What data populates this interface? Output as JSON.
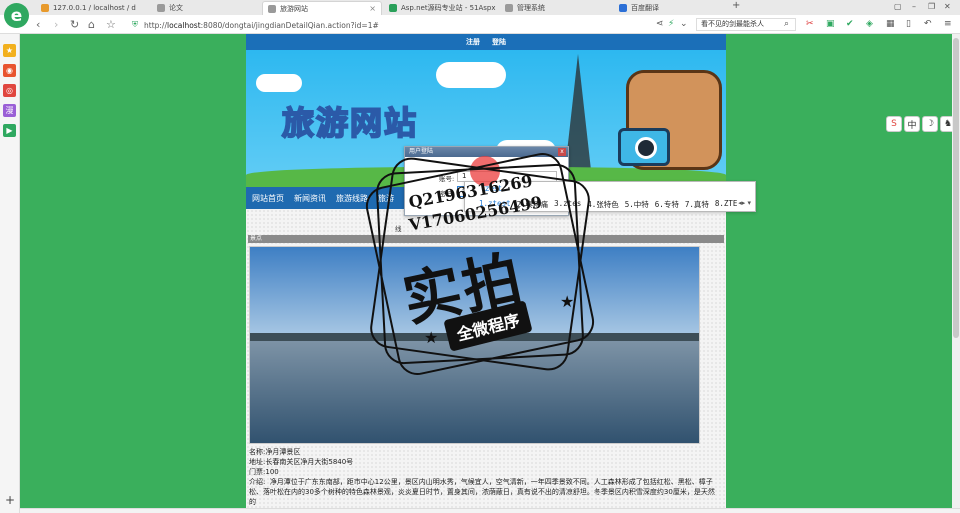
{
  "browser": {
    "tabs": [
      {
        "label": "127.0.0.1 / localhost / db_dongtai",
        "color": "#e89a2c"
      },
      {
        "label": "论文",
        "color": "#9a9a9a"
      },
      {
        "label": "旅游网站",
        "color": "#9a9a9a"
      },
      {
        "label": "Asp.net源码专业站 - 51Aspx.com",
        "color": "#2aa05a"
      },
      {
        "label": "管理系统",
        "color": "#9a9a9a"
      },
      {
        "label": "百度翻译",
        "color": "#2b6fd6"
      }
    ],
    "active_tab_index": 2,
    "new_tab_glyph": "+",
    "address": {
      "scheme": "http://",
      "host": "localhost",
      "path": ":8080/dongtai/jingdianDetailQian.action?id=1#"
    },
    "search_text": "看不见的剑最能杀人",
    "logo_glyph": "e"
  },
  "sidebar": {
    "icons": [
      {
        "name": "favorites-star-icon",
        "glyph": "★",
        "color": "#f2b01e"
      },
      {
        "name": "weibo-icon",
        "glyph": "◉",
        "color": "#e8532f"
      },
      {
        "name": "target-icon",
        "glyph": "◎",
        "color": "#e0463f"
      },
      {
        "name": "manga-icon",
        "glyph": "漫",
        "color": "#9a5fd6"
      },
      {
        "name": "video-icon",
        "glyph": "▶",
        "color": "#2fa860"
      }
    ],
    "add_glyph": "+"
  },
  "site": {
    "top_links": [
      "注册",
      "登陆"
    ],
    "banner_title": "旅游网站",
    "nav_items": [
      "网站首页",
      "新闻资讯",
      "旅游线路",
      "旅游"
    ],
    "section_header": "景点",
    "login_dialog": {
      "title": "用户登陆",
      "close": "x",
      "account_label": "账号:",
      "account_value": "1",
      "password_label": "密码:",
      "password_value": "ztest",
      "line_label": "线"
    },
    "details": {
      "name_label": "名称:",
      "name_value": "净月潭景区",
      "address_label": "地址:",
      "address_value": "长春南关区净月大街5840号",
      "tickets_label": "门票:",
      "tickets_value": "100",
      "intro_label": "介绍:",
      "intro_value": "净月潭位于广东东南部，距市中心12公里，景区内山明水秀，气候宜人，空气清新，一年四季景致不同。人工森林形成了包括红松、黑松、樟子松、落叶松在内的30多个树种的特色森林景观，炎炎夏日时节，置身其间，浓荫蔽日，真有说不出的清凉舒坦。冬季景区内积雪深度约30厘米，是天然的"
    }
  },
  "ime": {
    "composition": "zest",
    "candidates": [
      "1.ztest",
      "2.奏疼痛",
      "3.ztes",
      "4.张特色",
      "5.中特",
      "6.专特",
      "7.真特",
      "8.ZTE"
    ],
    "selected_index": 0
  },
  "float_widget": [
    "S",
    "中",
    "☽",
    "♞"
  ],
  "watermark": {
    "qq": "Q2196316269",
    "wechat": "V17060256499",
    "big_text": "实拍",
    "ribbon": "全微程序"
  }
}
